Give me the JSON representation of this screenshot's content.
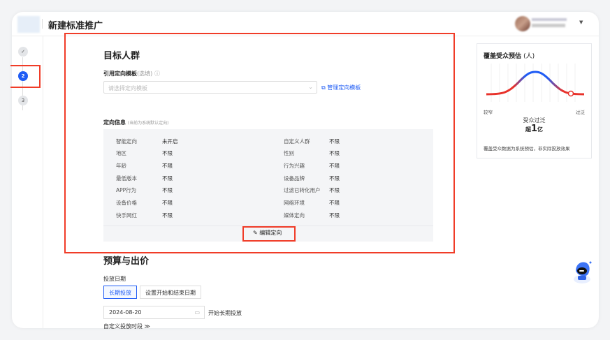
{
  "header": {
    "title": "新建标准推广",
    "user_menu_icon": "chevron-down-icon"
  },
  "steps": [
    {
      "label": "✓",
      "state": "done"
    },
    {
      "label": "2",
      "state": "active"
    },
    {
      "label": "3",
      "state": "pending"
    }
  ],
  "audience": {
    "title": "目标人群",
    "template_label": "引用定向模板",
    "template_optional": "(选填)",
    "template_placeholder": "请选择定向模板",
    "manage_link": "管理定向模板",
    "info_label": "定向信息",
    "info_note": "(当前为系统默认定向)",
    "left": [
      {
        "k": "智能定向",
        "v": "未开启"
      },
      {
        "k": "地区",
        "v": "不限"
      },
      {
        "k": "年龄",
        "v": "不限"
      },
      {
        "k": "最低版本",
        "v": "不限"
      },
      {
        "k": "APP行为",
        "v": "不限"
      },
      {
        "k": "设备价格",
        "v": "不限"
      },
      {
        "k": "快手网红",
        "v": "不限"
      }
    ],
    "right": [
      {
        "k": "自定义人群",
        "v": "不限"
      },
      {
        "k": "性别",
        "v": "不限"
      },
      {
        "k": "行为兴趣",
        "v": "不限"
      },
      {
        "k": "设备品牌",
        "v": "不限"
      },
      {
        "k": "过滤已转化用户",
        "v": "不限"
      },
      {
        "k": "网络环境",
        "v": "不限"
      },
      {
        "k": "媒体定向",
        "v": "不限"
      }
    ],
    "edit_button": "编辑定向"
  },
  "budget": {
    "title": "预算与出价",
    "date_label": "投放日期",
    "seg_long": "长期投放",
    "seg_range": "设置开始和结束日期",
    "start_date": "2024-08-20",
    "start_note": "开始长期投放",
    "custom_period": "自定义投放时段 ≫"
  },
  "estimate": {
    "title": "覆盖受众预估",
    "unit": "(人)",
    "left_label": "较窄",
    "right_label": "过泛",
    "status": "受众过泛",
    "prefix": "超",
    "number": "1",
    "suffix": "亿",
    "note": "覆盖受众数据为系统预估，非实际投放效果",
    "colors": {
      "narrow": "#e8322b",
      "ok": "#1f5cf5"
    }
  }
}
